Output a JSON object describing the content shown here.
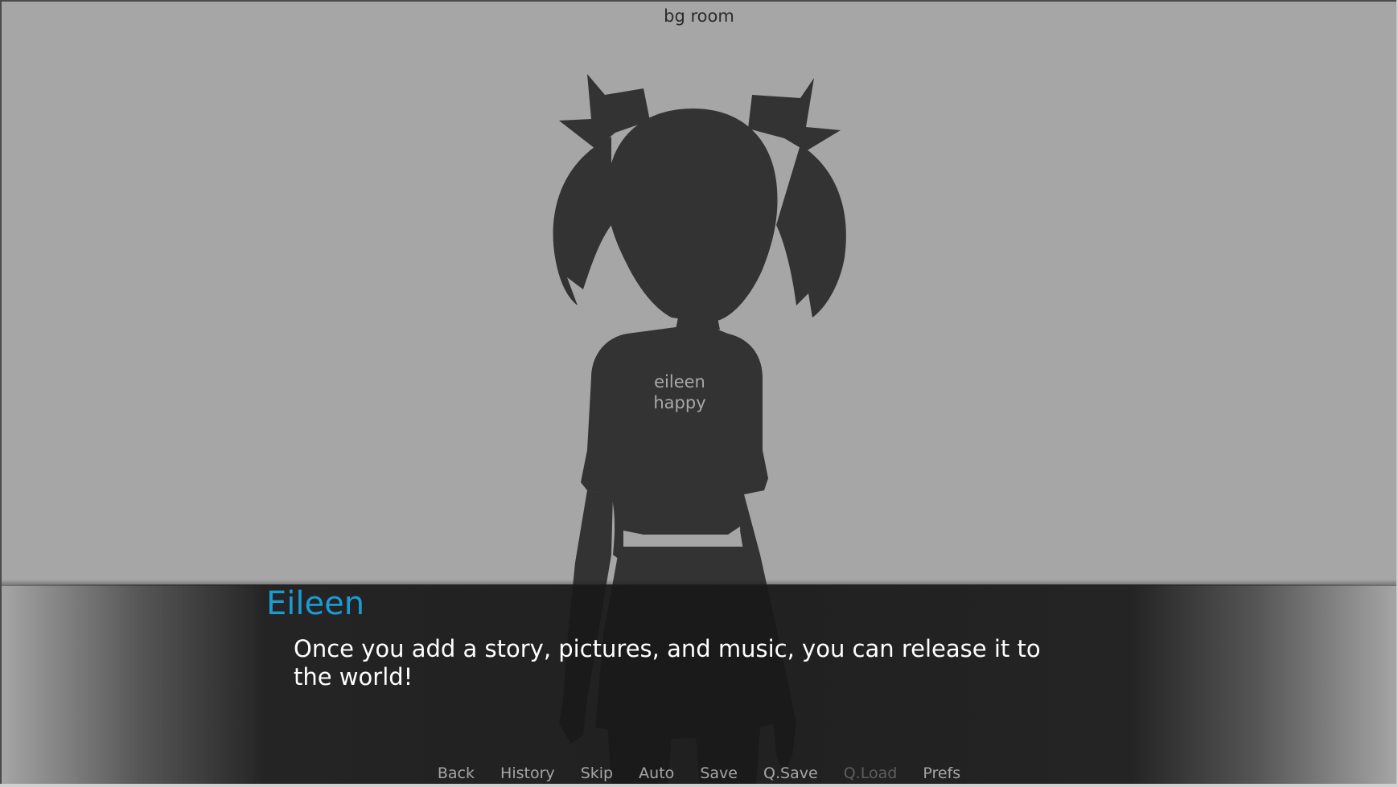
{
  "scene": {
    "background_label": "bg room",
    "background_color": "#a6a6a6"
  },
  "sprite": {
    "label": "eileen\nhappy",
    "label_line1": "eileen",
    "label_line2": "happy",
    "silhouette_color": "#333333"
  },
  "dialogue": {
    "speaker": "Eileen",
    "speaker_color": "#1b9bd1",
    "text": "Once you add a story, pictures, and music, you can release it to the world!"
  },
  "quick_menu": {
    "items": [
      {
        "label": "Back",
        "enabled": true
      },
      {
        "label": "History",
        "enabled": true
      },
      {
        "label": "Skip",
        "enabled": true
      },
      {
        "label": "Auto",
        "enabled": true
      },
      {
        "label": "Save",
        "enabled": true
      },
      {
        "label": "Q.Save",
        "enabled": true
      },
      {
        "label": "Q.Load",
        "enabled": false
      },
      {
        "label": "Prefs",
        "enabled": true
      }
    ]
  }
}
